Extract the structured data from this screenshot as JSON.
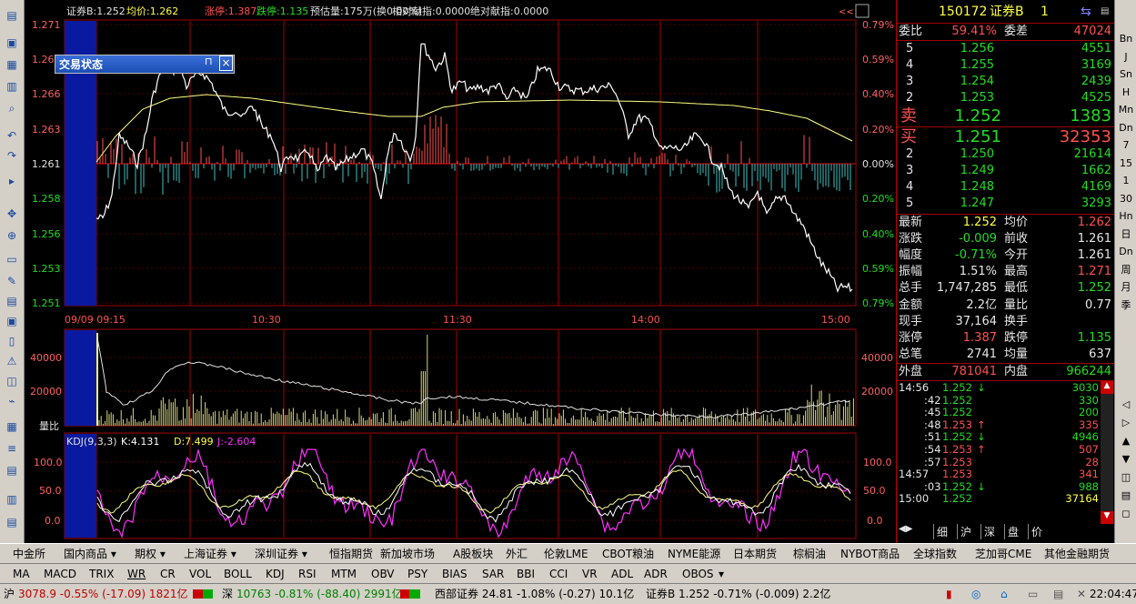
{
  "header": {
    "name": "证券B:1.252",
    "avg": "均价:1.262",
    "limit_up": "涨停:1.387",
    "limit_down": "跌停:1.135",
    "forecast": "预估量:175万(换0.00%)",
    "rel_contrib": "相对献指:0.0000",
    "abs_contrib": "绝对献指:0.0000"
  },
  "price_axis_left": [
    "1.271",
    "1.268",
    "1.266",
    "1.263",
    "1.261",
    "1.258",
    "1.256",
    "1.253",
    "1.251"
  ],
  "price_axis_right": [
    "0.79%",
    "0.59%",
    "0.40%",
    "0.20%",
    "0.00%",
    "0.20%",
    "0.40%",
    "0.59%",
    "0.79%"
  ],
  "time_axis": [
    "09/09 09:15",
    "10:30",
    "11:30",
    "14:00",
    "15:00"
  ],
  "volume_axis": [
    "40000",
    "20000"
  ],
  "volume_label": "量比",
  "kdj": {
    "title": "KDJ(9,3,3)",
    "k": "K:4.131",
    "d": "D:7.499",
    "j": "J:-2.604",
    "axis": [
      "100.0",
      "50.0",
      "0.0"
    ]
  },
  "trade_status_box": "交易状态",
  "quote": {
    "code": "150172",
    "name": "证券B",
    "num": "1",
    "wei_bi_label": "委比",
    "wei_bi": "59.41%",
    "wei_cha_label": "委差",
    "wei_cha": "47024",
    "sell": [
      {
        "lvl": "5",
        "price": "1.256",
        "vol": "4551"
      },
      {
        "lvl": "4",
        "price": "1.255",
        "vol": "3169"
      },
      {
        "lvl": "3",
        "price": "1.254",
        "vol": "2439"
      },
      {
        "lvl": "2",
        "price": "1.253",
        "vol": "4525"
      },
      {
        "lvl": "卖",
        "price": "1.252",
        "vol": "1383"
      }
    ],
    "buy": [
      {
        "lvl": "买",
        "price": "1.251",
        "vol": "32353"
      },
      {
        "lvl": "2",
        "price": "1.250",
        "vol": "21614"
      },
      {
        "lvl": "3",
        "price": "1.249",
        "vol": "1662"
      },
      {
        "lvl": "4",
        "price": "1.248",
        "vol": "4169"
      },
      {
        "lvl": "5",
        "price": "1.247",
        "vol": "3293"
      }
    ],
    "stats": [
      {
        "l1": "最新",
        "v1": "1.252",
        "c1": "y",
        "l2": "均价",
        "v2": "1.262",
        "c2": "r"
      },
      {
        "l1": "涨跌",
        "v1": "-0.009",
        "c1": "g",
        "l2": "前收",
        "v2": "1.261",
        "c2": "w"
      },
      {
        "l1": "幅度",
        "v1": "-0.71%",
        "c1": "g",
        "l2": "今开",
        "v2": "1.261",
        "c2": "w"
      },
      {
        "l1": "振幅",
        "v1": "1.51%",
        "c1": "w",
        "l2": "最高",
        "v2": "1.271",
        "c2": "r"
      },
      {
        "l1": "总手",
        "v1": "1,747,285",
        "c1": "w",
        "l2": "最低",
        "v2": "1.252",
        "c2": "g"
      },
      {
        "l1": "金额",
        "v1": "2.2亿",
        "c1": "w",
        "l2": "量比",
        "v2": "0.77",
        "c2": "w"
      },
      {
        "l1": "现手",
        "v1": "37,164",
        "c1": "w",
        "l2": "换手",
        "v2": "",
        "c2": "w"
      },
      {
        "l1": "涨停",
        "v1": "1.387",
        "c1": "r",
        "l2": "跌停",
        "v2": "1.135",
        "c2": "g"
      },
      {
        "l1": "总笔",
        "v1": "2741",
        "c1": "w",
        "l2": "均量",
        "v2": "637",
        "c2": "w"
      }
    ],
    "outer_label": "外盘",
    "outer": "781041",
    "inner_label": "内盘",
    "inner": "966244"
  },
  "ticks": [
    {
      "t": "14:56",
      "p": "1.252",
      "a": "↓",
      "v": "3030",
      "c": "g"
    },
    {
      "t": ":42",
      "p": "1.252",
      "a": "",
      "v": "330",
      "c": "g"
    },
    {
      "t": ":45",
      "p": "1.252",
      "a": "",
      "v": "200",
      "c": "g"
    },
    {
      "t": ":48",
      "p": "1.253",
      "a": "↑",
      "v": "335",
      "c": "r"
    },
    {
      "t": ":51",
      "p": "1.252",
      "a": "↓",
      "v": "4946",
      "c": "g"
    },
    {
      "t": ":54",
      "p": "1.253",
      "a": "↑",
      "v": "507",
      "c": "r"
    },
    {
      "t": ":57",
      "p": "1.253",
      "a": "",
      "v": "28",
      "c": "r"
    },
    {
      "t": "14:57",
      "p": "1.253",
      "a": "",
      "v": "341",
      "c": "r"
    },
    {
      "t": ":03",
      "p": "1.252",
      "a": "↓",
      "v": "988",
      "c": "g"
    },
    {
      "t": "15:00",
      "p": "1.252",
      "a": "",
      "v": "37164",
      "c": "y"
    }
  ],
  "panel_tabs": [
    "细",
    "沪",
    "深",
    "盘",
    "价"
  ],
  "right_toolbar": [
    "Bn",
    "J",
    "Sn",
    "H",
    "Mn",
    "Dn",
    "7",
    "15",
    "1",
    "30",
    "Hn",
    "日",
    "Dn",
    "周",
    "月",
    "季"
  ],
  "market_tabs": [
    "中金所",
    "国内商品 ▾",
    "期权 ▾",
    "上海证券 ▾",
    "深圳证券 ▾",
    "恒指期货",
    "新加坡市场",
    "A股板块",
    "外汇",
    "伦敦LME",
    "CBOT粮油",
    "NYME能源",
    "日本期货",
    "棕榈油",
    "NYBOT商品",
    "全球指数",
    "芝加哥CME",
    "其他金融期货"
  ],
  "indicator_tabs": [
    "MA",
    "MACD",
    "TRIX",
    "WR",
    "CR",
    "VOL",
    "BOLL",
    "KDJ",
    "RSI",
    "MTM",
    "OBV",
    "PSY",
    "BIAS",
    "SAR",
    "BBI",
    "CCI",
    "VR",
    "ADL",
    "ADR",
    "OBOS"
  ],
  "status": {
    "sh_label": "沪",
    "sh": "3078.9 -0.55% (-17.09) 1821亿",
    "sz_label": "深",
    "sz": "10763 -0.81% (-88.40) 2991亿",
    "west": "西部证券  24.81 -1.08% (-0.27) 10.1亿",
    "sec": "证券B 1.252 -0.71% (-0.009) 2.2亿",
    "clock": "22:04:47"
  },
  "colors": {
    "up": "#ff5050",
    "down": "#22dd22",
    "grid": "#a00000",
    "price": "#ffffff",
    "avg": "#ffff80",
    "kdj_j": "#ff30ff"
  }
}
